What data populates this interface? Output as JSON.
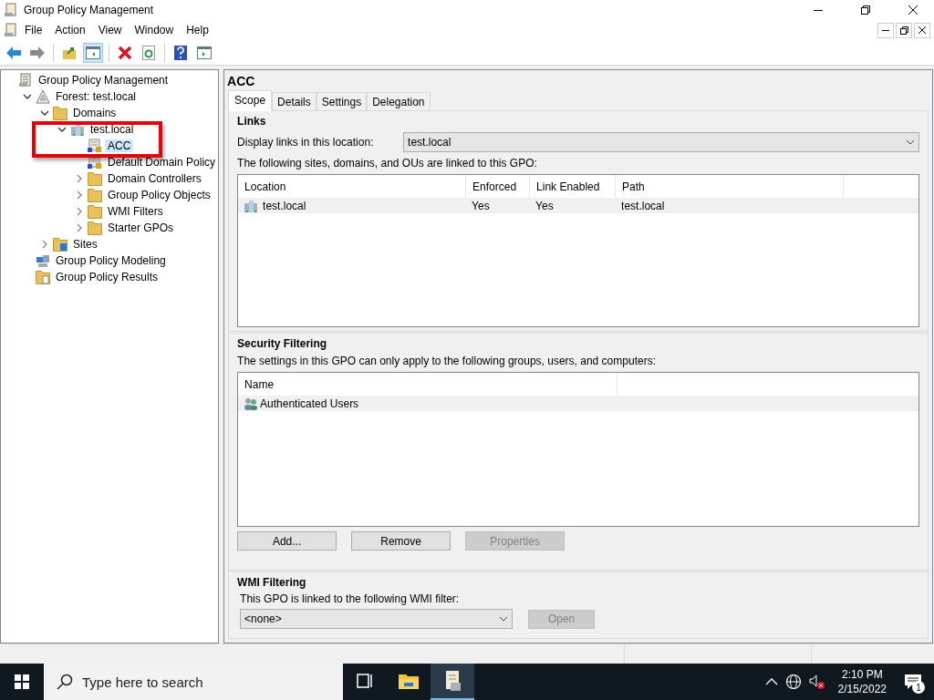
{
  "window": {
    "title": "Group Policy Management"
  },
  "menu": [
    "File",
    "Action",
    "View",
    "Window",
    "Help"
  ],
  "toolbar": [
    {
      "kind": "back",
      "disabled": false
    },
    {
      "kind": "forward",
      "disabled": true
    },
    {
      "kind": "up",
      "disabled": false
    },
    {
      "kind": "tree",
      "disabled": false,
      "pressed": true
    },
    {
      "kind": "delete",
      "disabled": false
    },
    {
      "kind": "refresh",
      "disabled": false
    },
    {
      "kind": "help",
      "disabled": false
    },
    {
      "kind": "pane",
      "disabled": false
    }
  ],
  "tree": [
    {
      "label": "Group Policy Management",
      "kind": "console",
      "selected": false,
      "children": [
        {
          "label": "Forest: test.local",
          "kind": "forest",
          "expanded": true,
          "selected": false,
          "children": [
            {
              "label": "Domains",
              "kind": "folder",
              "expanded": true,
              "selected": false,
              "children": [
                {
                  "label": "test.local",
                  "kind": "domain",
                  "expanded": true,
                  "selected": false,
                  "highlighted": true,
                  "children": [
                    {
                      "label": "ACC",
                      "kind": "gpo",
                      "selected": true
                    },
                    {
                      "label": "Default Domain Policy",
                      "kind": "gpo",
                      "selected": false
                    },
                    {
                      "label": "Domain Controllers",
                      "kind": "folder",
                      "expanded": false,
                      "selected": false
                    },
                    {
                      "label": "Group Policy Objects",
                      "kind": "folder",
                      "expanded": false,
                      "selected": false
                    },
                    {
                      "label": "WMI Filters",
                      "kind": "folder",
                      "expanded": false,
                      "selected": false
                    },
                    {
                      "label": "Starter GPOs",
                      "kind": "folder",
                      "expanded": false,
                      "selected": false
                    }
                  ]
                }
              ]
            },
            {
              "label": "Sites",
              "kind": "sites",
              "expanded": false,
              "selected": false
            }
          ]
        },
        {
          "label": "Group Policy Modeling",
          "kind": "modeling",
          "selected": false
        },
        {
          "label": "Group Policy Results",
          "kind": "results",
          "selected": false
        }
      ]
    }
  ],
  "details": {
    "title": "ACC",
    "tabs": [
      {
        "label": "Scope",
        "selected": true
      },
      {
        "label": "Details",
        "selected": false
      },
      {
        "label": "Settings",
        "selected": false
      },
      {
        "label": "Delegation",
        "selected": false
      }
    ],
    "links": {
      "heading": "Links",
      "location_label": "Display links in this location:",
      "location_value": "test.local",
      "list_caption": "The following sites, domains, and OUs are linked to this GPO:",
      "columns": [
        "Location",
        "Enforced",
        "Link Enabled",
        "Path"
      ],
      "rows": [
        {
          "cells": [
            "test.local",
            "Yes",
            "Yes",
            "test.local"
          ],
          "selected": true
        }
      ]
    },
    "security": {
      "heading": "Security Filtering",
      "caption": "The settings in this GPO can only apply to the following groups, users, and computers:",
      "columns": [
        "Name"
      ],
      "rows": [
        {
          "cells": [
            "Authenticated Users"
          ],
          "selected": true
        }
      ],
      "buttons": [
        {
          "label": "Add...",
          "disabled": false
        },
        {
          "label": "Remove",
          "disabled": false
        },
        {
          "label": "Properties",
          "disabled": true
        }
      ]
    },
    "wmi": {
      "heading": "WMI Filtering",
      "caption": "This GPO is linked to the following WMI filter:",
      "value": "<none>",
      "button": {
        "label": "Open",
        "disabled": true
      }
    }
  },
  "taskbar": {
    "search_placeholder": "Type here to search",
    "apps": [
      {
        "kind": "taskview",
        "active": false
      },
      {
        "kind": "explorer",
        "active": false
      },
      {
        "kind": "gpm",
        "active": true
      }
    ],
    "time": "2:10 PM",
    "date": "2/15/2022",
    "notifications": "1"
  }
}
